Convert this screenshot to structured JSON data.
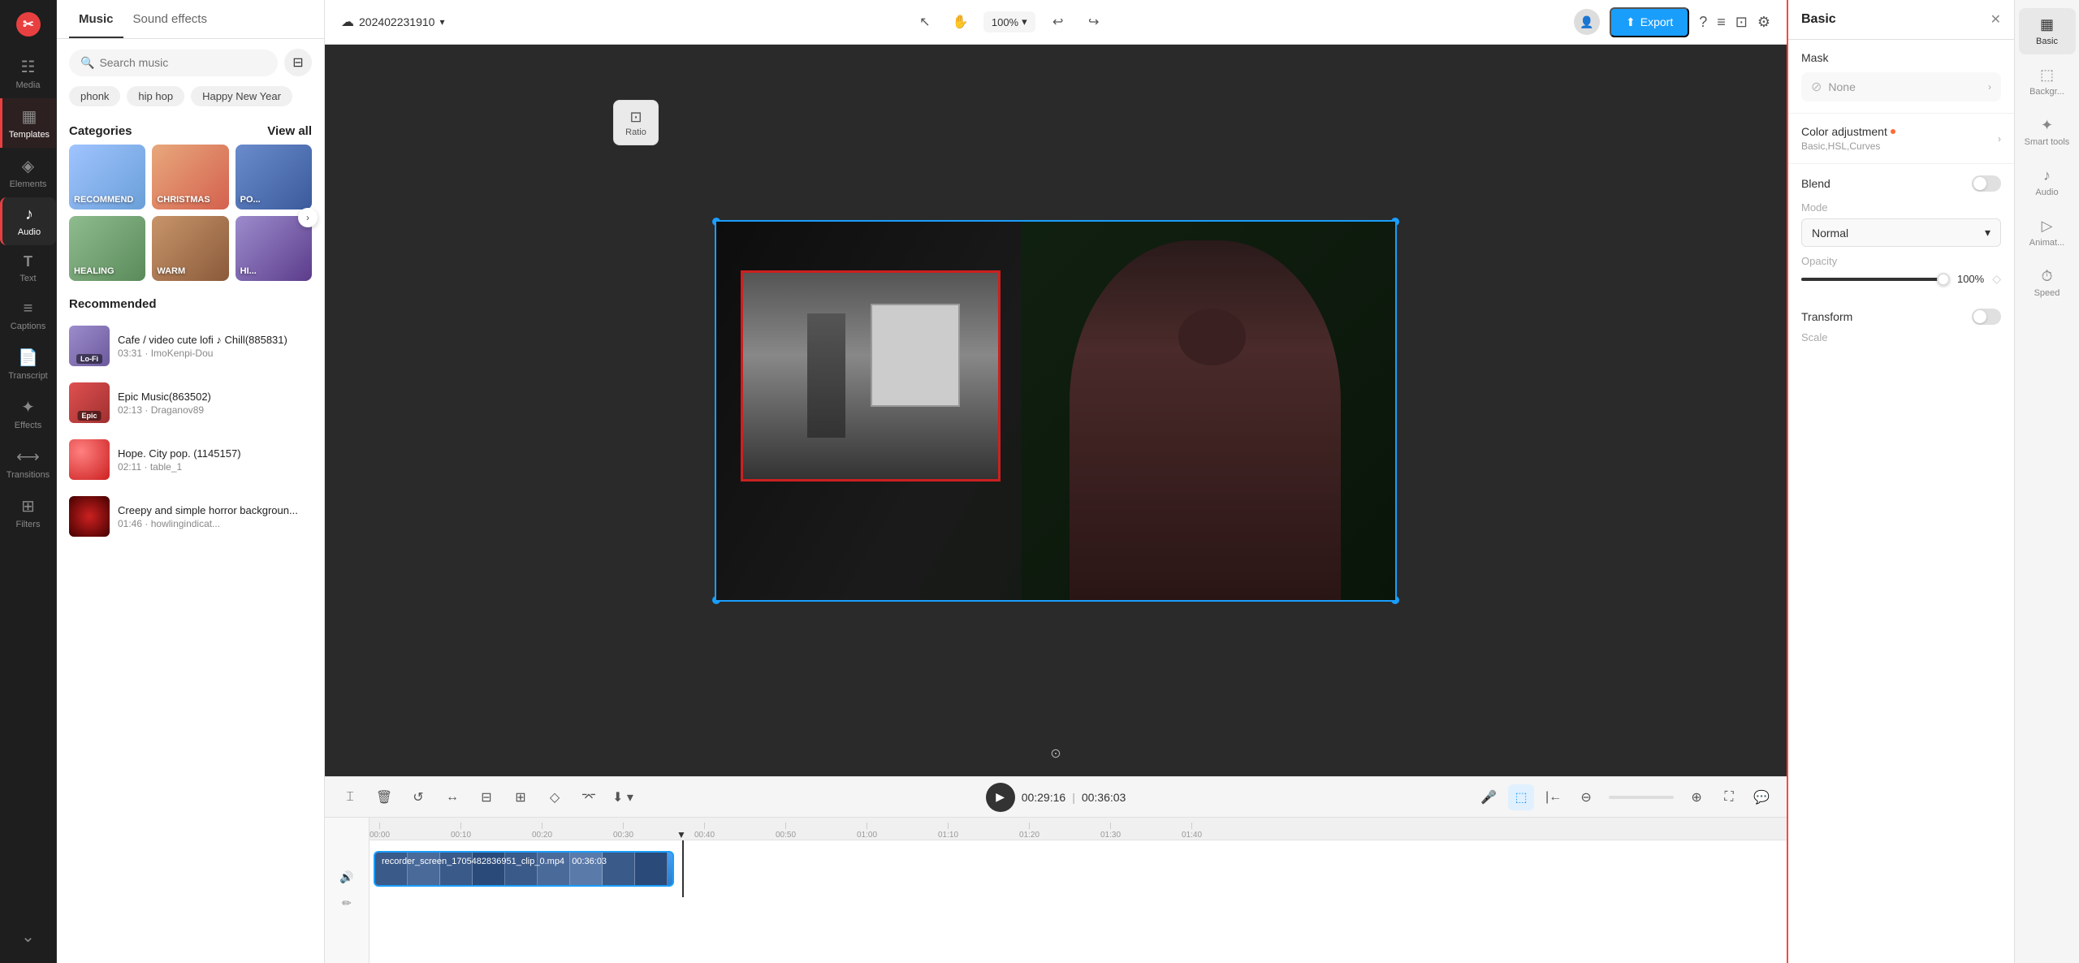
{
  "app": {
    "logo": "✂",
    "project_name": "202402231910",
    "export_label": "Export"
  },
  "sidebar": {
    "items": [
      {
        "id": "media",
        "icon": "⬜",
        "label": "Media"
      },
      {
        "id": "templates",
        "icon": "▦",
        "label": "Templates"
      },
      {
        "id": "elements",
        "icon": "◈",
        "label": "Elements"
      },
      {
        "id": "audio",
        "icon": "♪",
        "label": "Audio"
      },
      {
        "id": "text",
        "icon": "T",
        "label": "Text"
      },
      {
        "id": "captions",
        "icon": "≡",
        "label": "Captions"
      },
      {
        "id": "transcript",
        "icon": "📄",
        "label": "Transcript"
      },
      {
        "id": "effects",
        "icon": "✦",
        "label": "Effects"
      },
      {
        "id": "transitions",
        "icon": "⟷",
        "label": "Transitions"
      },
      {
        "id": "filters",
        "icon": "⊞",
        "label": "Filters"
      }
    ]
  },
  "music_panel": {
    "tab_music": "Music",
    "tab_sound_effects": "Sound effects",
    "search_placeholder": "Search music",
    "tags": [
      "phonk",
      "hip hop",
      "Happy New Year"
    ],
    "categories_label": "Categories",
    "view_all": "View all",
    "categories": [
      {
        "label": "RECOMMEND",
        "style": "recommend"
      },
      {
        "label": "CHRISTMAS",
        "style": "christmas"
      },
      {
        "label": "PO...",
        "style": "pop"
      },
      {
        "label": "HEALING",
        "style": "healing"
      },
      {
        "label": "WARM",
        "style": "warm"
      },
      {
        "label": "HI...",
        "style": "hitem"
      }
    ],
    "recommended_label": "Recommended",
    "tracks": [
      {
        "name": "Cafe / video cute lofi ♪ Chill(885831)",
        "duration": "03:31",
        "artist": "ImoKenpi-Dou",
        "style": "lofi",
        "tag": "Lo-Fi"
      },
      {
        "name": "Epic Music(863502)",
        "duration": "02:13",
        "artist": "Draganov89",
        "style": "epic",
        "tag": "Epic"
      },
      {
        "name": "Hope. City pop. (1145157)",
        "duration": "02:11",
        "artist": "table_1",
        "style": "city",
        "tag": ""
      },
      {
        "name": "Creepy and simple horror backgroun...",
        "duration": "01:46",
        "artist": "howlingindicat...",
        "style": "horror",
        "tag": ""
      }
    ]
  },
  "toolbar": {
    "zoom": "100%",
    "time_current": "00:29:16",
    "time_total": "00:36:03",
    "ratio_label": "Ratio"
  },
  "timeline": {
    "clip_name": "recorder_screen_1705482836951_clip_0.mp4",
    "clip_duration": "00:36:03"
  },
  "right_panel": {
    "title": "Basic",
    "mask_label": "Mask",
    "mask_none": "None",
    "color_adj_label": "Color adjustment",
    "color_adj_sub": "Basic,HSL,Curves",
    "blend_label": "Blend",
    "mode_label": "Mode",
    "mode_value": "Normal",
    "opacity_label": "Opacity",
    "opacity_value": "100%",
    "transform_label": "Transform",
    "scale_label": "Scale"
  },
  "far_right_tabs": [
    {
      "id": "basic",
      "icon": "▦",
      "label": "Basic",
      "active": true
    },
    {
      "id": "background",
      "icon": "⬚",
      "label": "Backgr..."
    },
    {
      "id": "smart_tools",
      "icon": "✦",
      "label": "Smart tools"
    },
    {
      "id": "audio_tab",
      "icon": "♪",
      "label": "Audio"
    },
    {
      "id": "animate",
      "icon": "▶",
      "label": "Animat..."
    },
    {
      "id": "speed",
      "icon": "⏱",
      "label": "Speed"
    }
  ]
}
